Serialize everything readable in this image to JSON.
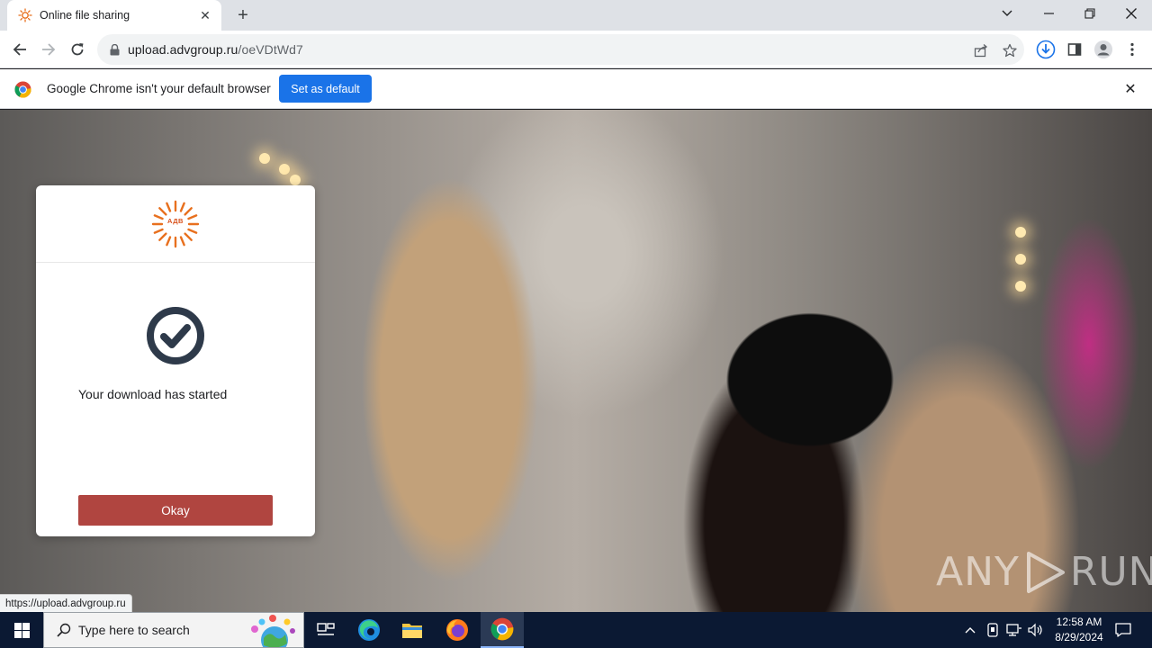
{
  "browser": {
    "tab": {
      "title": "Online file sharing",
      "favicon": "adv-sun-logo-icon"
    },
    "url": {
      "host": "upload.advgroup.ru",
      "path": "/oeVDtWd7"
    },
    "status_url": "https://upload.advgroup.ru"
  },
  "infobar": {
    "message": "Google Chrome isn't your default browser",
    "button_label": "Set as default"
  },
  "modal": {
    "logo_text": "АДВ",
    "message": "Your download has started",
    "button_label": "Okay"
  },
  "watermark": {
    "left": "ANY",
    "right": "RUN"
  },
  "taskbar": {
    "search_placeholder": "Type here to search",
    "time": "12:58 AM",
    "date": "8/29/2024"
  },
  "colors": {
    "okay_button": "#b04540",
    "infobar_button": "#1a73e8",
    "taskbar": "#0b1933",
    "brand_orange": "#e8701e"
  }
}
